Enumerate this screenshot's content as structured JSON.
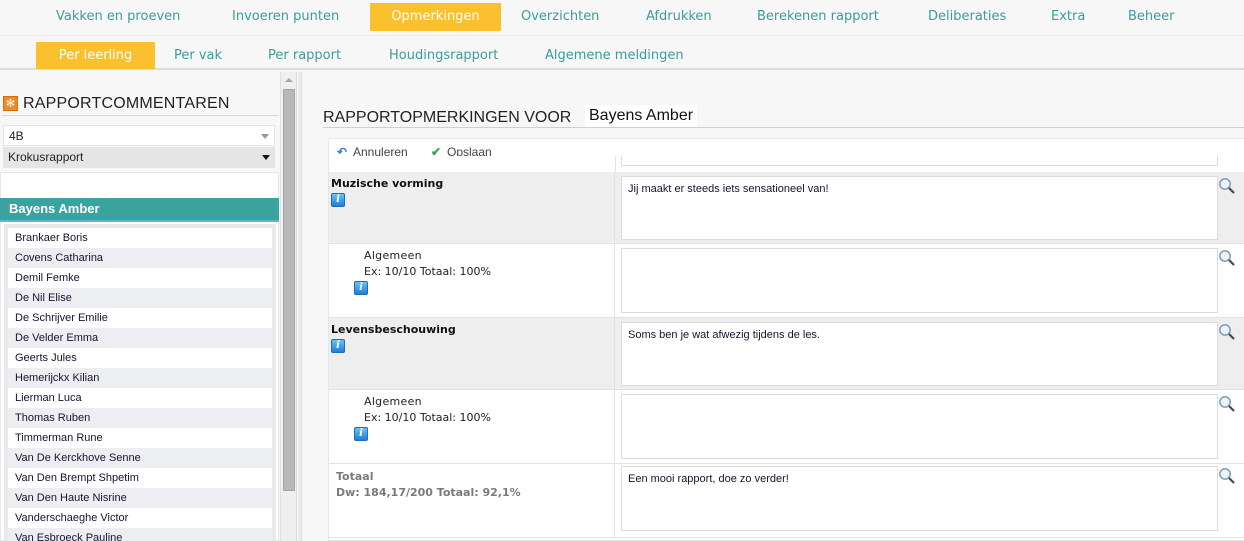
{
  "top_nav": {
    "items": [
      {
        "label": "Vakken en proeven",
        "active": false
      },
      {
        "label": "Invoeren punten",
        "active": false
      },
      {
        "label": "Opmerkingen",
        "active": true
      },
      {
        "label": "Overzichten",
        "active": false
      },
      {
        "label": "Afdrukken",
        "active": false
      },
      {
        "label": "Berekenen rapport",
        "active": false
      },
      {
        "label": "Deliberaties",
        "active": false
      },
      {
        "label": "Extra",
        "active": false
      },
      {
        "label": "Beheer",
        "active": false
      }
    ]
  },
  "sub_nav": {
    "items": [
      {
        "label": "Per leerling",
        "active": true
      },
      {
        "label": "Per vak",
        "active": false
      },
      {
        "label": "Per rapport",
        "active": false
      },
      {
        "label": "Houdingsrapport",
        "active": false
      },
      {
        "label": "Algemene meldingen",
        "active": false
      }
    ]
  },
  "sidebar": {
    "title": "RAPPORTCOMMENTAREN",
    "title_icon": "gear-icon",
    "class_select": {
      "value": "4B"
    },
    "report_select": {
      "value": "Krokusrapport"
    },
    "selected_student": "Bayens Amber",
    "students": [
      "Brankaer Boris",
      "Covens Catharina",
      "Demil Femke",
      "De Nil Elise",
      "De Schrijver Emilie",
      "De Velder Emma",
      "Geerts Jules",
      "Hemerijckx Kilian",
      "Lierman Luca",
      "Thomas Ruben",
      "Timmerman Rune",
      "Van De Kerckhove Senne",
      "Van Den Brempt Shpetim",
      "Van Den Haute Nisrine",
      "Vanderschaeghe Victor",
      "Van Esbroeck Pauline"
    ]
  },
  "main": {
    "title_prefix": "RAPPORTOPMERKINGEN VOOR",
    "student_name": "Bayens Amber",
    "toolbar": {
      "cancel_label": "Annuleren",
      "cancel_icon": "undo-icon",
      "save_label": "Opslaan",
      "save_icon": "checkmark-icon"
    },
    "info_glyph": "i",
    "rows": [
      {
        "type": "subject",
        "title": "Muzische vorming",
        "comment": "Jij maakt er steeds iets sensationeel van!"
      },
      {
        "type": "sub",
        "title": "Algemeen",
        "score": "Ex: 10/10 Totaal: 100%",
        "comment": ""
      },
      {
        "type": "subject",
        "title": "Levensbeschouwing",
        "comment": "Soms ben je wat afwezig tijdens de les."
      },
      {
        "type": "sub",
        "title": "Algemeen",
        "score": "Ex: 10/10 Totaal: 100%",
        "comment": ""
      },
      {
        "type": "total",
        "title": "Totaal",
        "score": "Dw: 184,17/200 Totaal: 92,1%",
        "comment": "Een mooi rapport, doe zo verder!"
      }
    ]
  },
  "colors": {
    "accent": "#fbc02d",
    "nav_text": "#3b9c9a",
    "selected_student_bg": "#3aa3a0",
    "title_icon_bg": "#f08a24"
  }
}
